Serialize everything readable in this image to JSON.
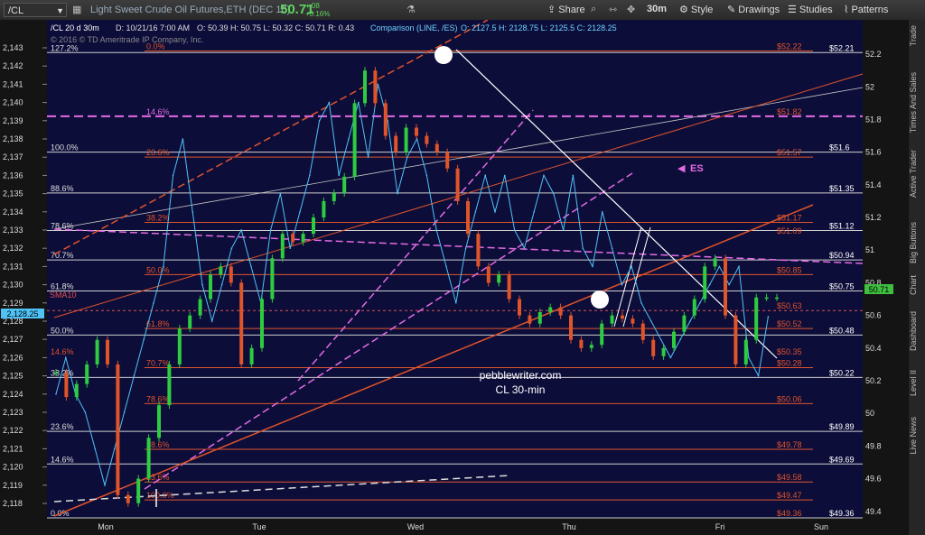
{
  "toolbar": {
    "symbol": "/CL",
    "description": "Light Sweet Crude Oil Futures,ETH (DEC 16)",
    "price": "50.71",
    "change": "+.08",
    "change_pct": "+0.16%",
    "share": "Share",
    "interval": "30m",
    "style": "Style",
    "drawings": "Drawings",
    "studies": "Studies",
    "patterns": "Patterns"
  },
  "sidebar": [
    "Trade",
    "Times And Sales",
    "Active Trader",
    "Big Buttons",
    "Chart",
    "Dashboard",
    "Level II",
    "Live News"
  ],
  "header": {
    "line1": "/CL 20 d 30m",
    "date": "D: 10/21/16 7:00 AM",
    "ohlc": "O: 50.39  H: 50.75  L: 50.32  C: 50.71  R: 0.43",
    "comparison": "Comparison (LINE, /ES)",
    "es_ohlc": "O: 2127.5  H: 2128.75  L: 2125.5  C: 2128.25",
    "copyright": "© 2016 © TD Ameritrade IP Company, Inc."
  },
  "watermark": [
    "pebblewriter.com",
    "CL 30-min"
  ],
  "es_label": "ES",
  "sma_label": "SMA10",
  "es_current": "2,128.25",
  "cl_current": "50.71",
  "chart_data": {
    "type": "line",
    "x_ticks": [
      "Mon",
      "Tue",
      "Wed",
      "Thu",
      "Fri",
      "Sun"
    ],
    "left_axis": {
      "ticks": [
        "2,118",
        "2,119",
        "2,120",
        "2,121",
        "2,122",
        "2,123",
        "2,124",
        "2,125",
        "2,126",
        "2,127",
        "2,128",
        "2,129",
        "2,130",
        "2,131",
        "2,132",
        "2,133",
        "2,134",
        "2,135",
        "2,136",
        "2,137",
        "2,138",
        "2,139",
        "2,140",
        "2,141",
        "2,142",
        "2,143"
      ],
      "range": [
        2118,
        2143
      ]
    },
    "right_axis": {
      "ticks": [
        "49.4",
        "49.6",
        "49.8",
        "50",
        "50.2",
        "50.4",
        "50.6",
        "50.8",
        "51",
        "51.2",
        "51.4",
        "51.6",
        "51.8",
        "52",
        "52.2"
      ],
      "range": [
        49.36,
        52.3
      ]
    },
    "white_levels": [
      {
        "label": "127.2%",
        "value": 52.21,
        "price": "$52.21"
      },
      {
        "label": "100.0%",
        "value": 51.6,
        "price": "$51.6"
      },
      {
        "label": "88.6%",
        "value": 51.35,
        "price": "$51.35"
      },
      {
        "label": "78.6%",
        "value": 51.12,
        "price": "$51.12"
      },
      {
        "label": "70.7%",
        "value": 50.94,
        "price": "$50.94"
      },
      {
        "label": "61.8%",
        "value": 50.75,
        "price": "$50.75"
      },
      {
        "label": "50.0%",
        "value": 50.48,
        "price": "$50.48"
      },
      {
        "label": "38.2%",
        "value": 50.22,
        "price": "$50.22"
      },
      {
        "label": "23.6%",
        "value": 49.89,
        "price": "$49.89"
      },
      {
        "label": "14.6%",
        "value": 49.69,
        "price": "$49.69"
      },
      {
        "label": "0.0%",
        "value": 49.36,
        "price": "$49.36"
      }
    ],
    "red_levels": [
      {
        "label": "0.0%",
        "value": 52.22,
        "price": "$52.22"
      },
      {
        "label": "23.6%",
        "value": 51.57,
        "price": "$51.57"
      },
      {
        "label": "38.2%",
        "value": 51.17,
        "price": "$51.17"
      },
      {
        "label": "50.0%",
        "value": 50.85,
        "price": "$50.85"
      },
      {
        "label": "61.8%",
        "value": 50.52,
        "price": "$50.52"
      },
      {
        "label": "70.7%",
        "value": 50.28,
        "price": "$50.28"
      },
      {
        "label": "78.6%",
        "value": 50.06,
        "price": "$50.06"
      },
      {
        "label": "88.6%",
        "value": 49.78,
        "price": "$49.78"
      },
      {
        "label": "23.6%",
        "value": 49.58,
        "price": "$49.58"
      },
      {
        "label": "100.0%",
        "value": 49.47,
        "price": "$49.47"
      }
    ],
    "extra_labels": [
      {
        "label": "14.6%",
        "value": 50.35,
        "price": "$50.35"
      },
      {
        "label": "",
        "value": 51.82,
        "price": "$51.82"
      },
      {
        "label": "",
        "value": 50.63,
        "price": "$50.63"
      },
      {
        "label": "",
        "value": 51.09,
        "price": "$51.09"
      },
      {
        "label": "",
        "value": 49.36,
        "price": "$49.36"
      }
    ],
    "magenta_level": {
      "label": "14.6%",
      "value": 51.82
    },
    "sma10": 50.63,
    "cl_series": {
      "name": "/CL",
      "x": [
        0,
        12,
        24,
        36,
        48,
        60,
        72,
        84,
        96,
        108,
        120,
        132,
        144,
        156,
        168,
        180,
        192,
        204,
        216,
        228,
        240,
        252,
        264,
        276,
        288,
        300,
        312,
        324,
        336,
        348,
        360,
        372,
        384,
        396,
        408,
        420,
        432,
        444,
        456,
        468,
        480,
        492,
        504,
        516,
        528,
        540,
        552,
        564,
        576,
        588,
        600,
        612,
        624,
        636,
        648,
        660,
        672,
        684,
        696,
        708,
        720,
        732,
        744,
        756,
        768,
        780,
        792,
        804,
        816,
        828,
        840
      ],
      "close": [
        50.25,
        50.1,
        50.18,
        50.3,
        50.45,
        50.3,
        49.5,
        49.45,
        49.6,
        49.85,
        50.05,
        50.3,
        50.52,
        50.6,
        50.7,
        50.85,
        50.9,
        50.8,
        50.3,
        50.4,
        50.7,
        50.95,
        51.1,
        51.05,
        51.1,
        51.2,
        51.3,
        51.35,
        51.45,
        51.9,
        52.1,
        51.9,
        51.7,
        51.6,
        51.75,
        51.7,
        51.65,
        51.6,
        51.5,
        51.3,
        51.1,
        50.9,
        50.8,
        50.85,
        50.7,
        50.6,
        50.55,
        50.62,
        50.65,
        50.6,
        50.45,
        50.4,
        50.42,
        50.55,
        50.6,
        50.58,
        50.55,
        50.45,
        50.35,
        50.4,
        50.5,
        50.6,
        50.7,
        50.9,
        50.95,
        50.6,
        50.3,
        50.45,
        50.71,
        50.71,
        50.71
      ]
    },
    "es_series": {
      "name": "/ES",
      "x": [
        0,
        10,
        20,
        30,
        40,
        50,
        60,
        70,
        80,
        90,
        100,
        110,
        120,
        130,
        140,
        150,
        160,
        170,
        180,
        190,
        200,
        210,
        220,
        230,
        240,
        250,
        260,
        270,
        280,
        290,
        300,
        310,
        320,
        330,
        340,
        350,
        360,
        370,
        380,
        390,
        400,
        410,
        420,
        430,
        440,
        450,
        460,
        470,
        480,
        490,
        500,
        510,
        520,
        530,
        540,
        550,
        560,
        570,
        580,
        590,
        600,
        610,
        620,
        630,
        640,
        650,
        660,
        670,
        680,
        690,
        700,
        710,
        720,
        730
      ],
      "values": [
        2124,
        2126,
        2124,
        2123,
        2121,
        2119,
        2121,
        2123,
        2125,
        2127,
        2129,
        2131,
        2136,
        2138,
        2134,
        2130,
        2128,
        2130,
        2132,
        2133,
        2131,
        2129,
        2133,
        2135,
        2132,
        2134,
        2136,
        2139,
        2140,
        2136,
        2138,
        2140,
        2137,
        2141,
        2139,
        2135,
        2137,
        2138,
        2136,
        2133,
        2131,
        2129,
        2132,
        2134,
        2136,
        2134,
        2136,
        2133,
        2132,
        2134,
        2136,
        2135,
        2133,
        2136,
        2132,
        2131,
        2134,
        2132,
        2130,
        2131,
        2129,
        2128,
        2127,
        2126,
        2127,
        2128,
        2129,
        2130,
        2131,
        2130,
        2131,
        2126,
        2125,
        2128.25
      ]
    }
  }
}
